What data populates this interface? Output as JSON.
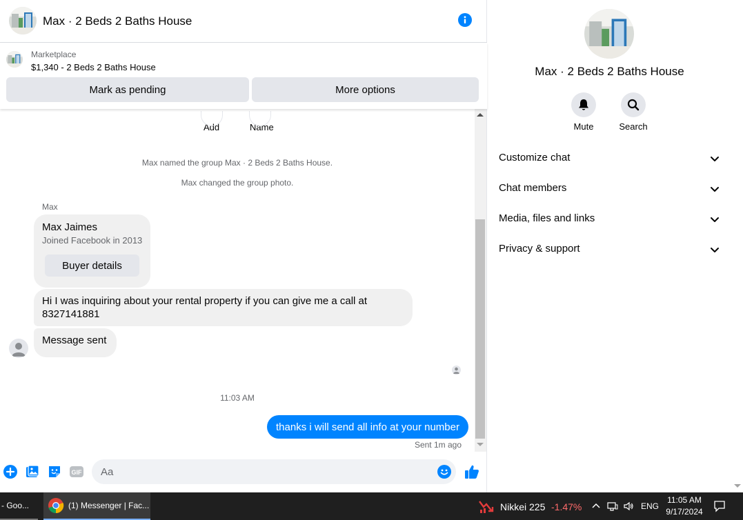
{
  "chat": {
    "title": "Max · 2 Beds 2 Baths House",
    "marketplace_label": "Marketplace",
    "listing_title": "$1,340 - 2 Beds 2 Baths House",
    "mark_pending_label": "Mark as pending",
    "more_options_label": "More options",
    "mini_actions": [
      "Add",
      "Name"
    ],
    "system_messages": [
      "Max named the group Max · 2 Beds 2 Baths House.",
      "Max changed the group photo."
    ],
    "sender_name": "Max",
    "profile_card": {
      "name": "Max Jaimes",
      "subtitle": "Joined Facebook in 2013",
      "button_label": "Buyer details"
    },
    "incoming_message_1": "Hi I was inquiring about your rental property if you can give me a call at 8327141881",
    "incoming_message_2": "Message sent",
    "timestamp": "11:03 AM",
    "outgoing_message": "thanks i will send all info at your number",
    "sent_status": "Sent 1m ago",
    "composer_placeholder": "Aa"
  },
  "info_panel": {
    "title": "Max · 2 Beds 2 Baths House",
    "mute_label": "Mute",
    "search_label": "Search",
    "menu": [
      "Customize chat",
      "Chat members",
      "Media, files and links",
      "Privacy & support"
    ]
  },
  "taskbar": {
    "item_1_label": "- Goo...",
    "item_2_label": "(1) Messenger | Fac...",
    "ticker_name": "Nikkei 225",
    "ticker_change": "-1.47%",
    "language": "ENG",
    "time": "11:05 AM",
    "date": "9/17/2024"
  },
  "colors": {
    "accent": "#0084ff",
    "bubble_incoming": "#f0f0f0",
    "button_grey": "#e4e6eb",
    "taskbar_bg": "#1f1f1f",
    "ticker_negative": "#ff6b6b"
  },
  "icons": {
    "info": "info-icon",
    "add": "plus-icon",
    "photo": "image-icon",
    "sticker": "sticker-icon",
    "gif": "gif-icon",
    "emoji": "emoji-icon",
    "like": "thumbs-up-icon",
    "mute": "bell-icon",
    "search": "search-icon",
    "chevron": "chevron-down-icon"
  }
}
